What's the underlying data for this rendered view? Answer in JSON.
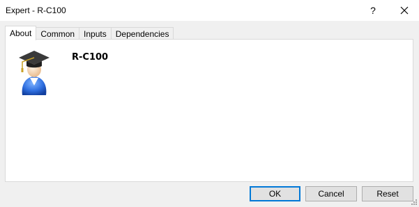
{
  "window": {
    "title": "Expert - R-C100",
    "help_label": "?"
  },
  "tabs": [
    {
      "label": "About",
      "active": true
    },
    {
      "label": "Common",
      "active": false
    },
    {
      "label": "Inputs",
      "active": false
    },
    {
      "label": "Dependencies",
      "active": false
    }
  ],
  "about": {
    "icon": "graduate-expert-icon",
    "expert_name": "R-C100"
  },
  "buttons": {
    "ok": "OK",
    "cancel": "Cancel",
    "reset": "Reset"
  },
  "colors": {
    "accent": "#0078d7",
    "panel_bg": "#ffffff",
    "dialog_bg": "#f0f0f0"
  }
}
